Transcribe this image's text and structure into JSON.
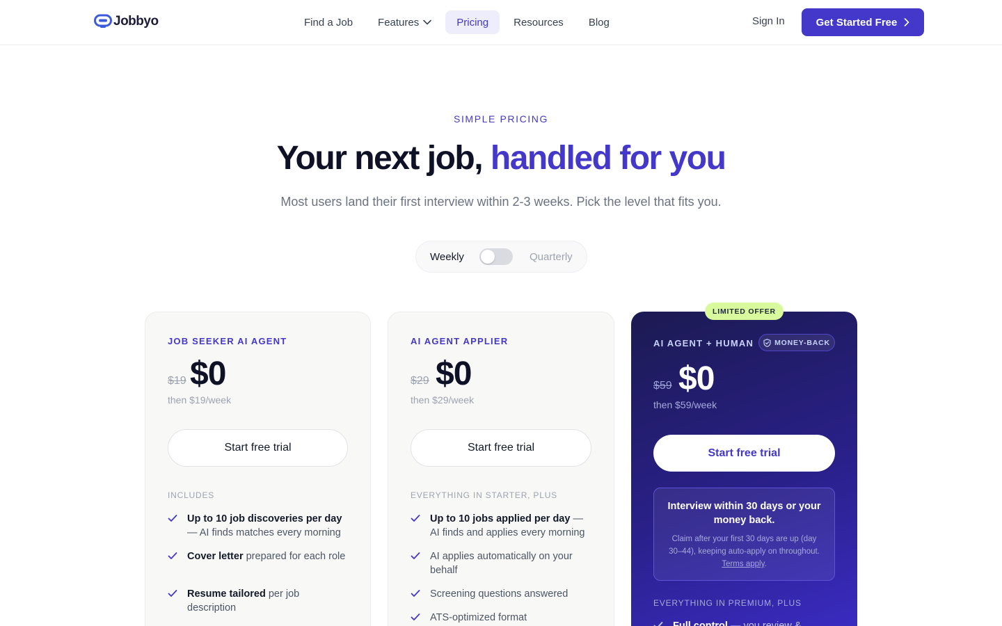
{
  "nav": {
    "logo_text": "Jobbyo",
    "links": [
      {
        "label": "Find a Job"
      },
      {
        "label": "Features"
      },
      {
        "label": "Pricing"
      },
      {
        "label": "Resources"
      },
      {
        "label": "Blog"
      }
    ],
    "active_link": "Pricing",
    "sign_in": "Sign In",
    "cta": "Get Started Free"
  },
  "hero": {
    "eyebrow": "SIMPLE PRICING",
    "headline_plain": "Your next job, ",
    "headline_accent": "handled for you",
    "subhead": "Most users land their first interview within 2-3 weeks. Pick the level that fits you."
  },
  "billing_toggle": {
    "weekly": "Weekly",
    "quarterly": "Quarterly",
    "selected": "Weekly"
  },
  "plans": [
    {
      "name": "JOB SEEKER AI AGENT",
      "old_price": "$19",
      "price": "$0",
      "then": "then $19/week",
      "button": "Start free trial",
      "features_heading": "INCLUDES",
      "features": [
        {
          "bold": "Up to 10 job discoveries per day",
          "rest": " — AI finds matches every morning"
        },
        {
          "bold": "Cover letter",
          "rest": " prepared for each role"
        },
        {
          "bold": "Resume tailored",
          "rest": " per job description"
        }
      ]
    },
    {
      "name": "AI AGENT APPLIER",
      "old_price": "$29",
      "price": "$0",
      "then": "then $29/week",
      "button": "Start free trial",
      "features_heading": "EVERYTHING IN STARTER, PLUS",
      "features": [
        {
          "bold": "Up to 10 jobs applied per day",
          "rest": " — AI finds and applies every morning"
        },
        {
          "bold": "",
          "rest": "AI applies automatically on your behalf"
        },
        {
          "bold": "",
          "rest": "Screening questions answered"
        },
        {
          "bold": "",
          "rest": "ATS-optimized format"
        }
      ]
    },
    {
      "name": "AI AGENT + HUMAN",
      "ribbon": "LIMITED OFFER",
      "badge": "MONEY-BACK",
      "old_price": "$59",
      "price": "$0",
      "then": "then $59/week",
      "button": "Start free trial",
      "guarantee_title": "Interview within 30 days or your money back.",
      "guarantee_body": "Claim after your first 30 days are up (day 30–44), keeping auto-apply on throughout. ",
      "guarantee_link": "Terms apply",
      "guarantee_end": ".",
      "features_heading": "EVERYTHING IN PREMIUM, PLUS",
      "features": [
        {
          "bold": "Full control",
          "rest": " — you review &"
        }
      ]
    }
  ],
  "colors": {
    "accent": "#4338ca",
    "dark_card": "#2a208a",
    "limited_badge": "#d9f99d"
  }
}
